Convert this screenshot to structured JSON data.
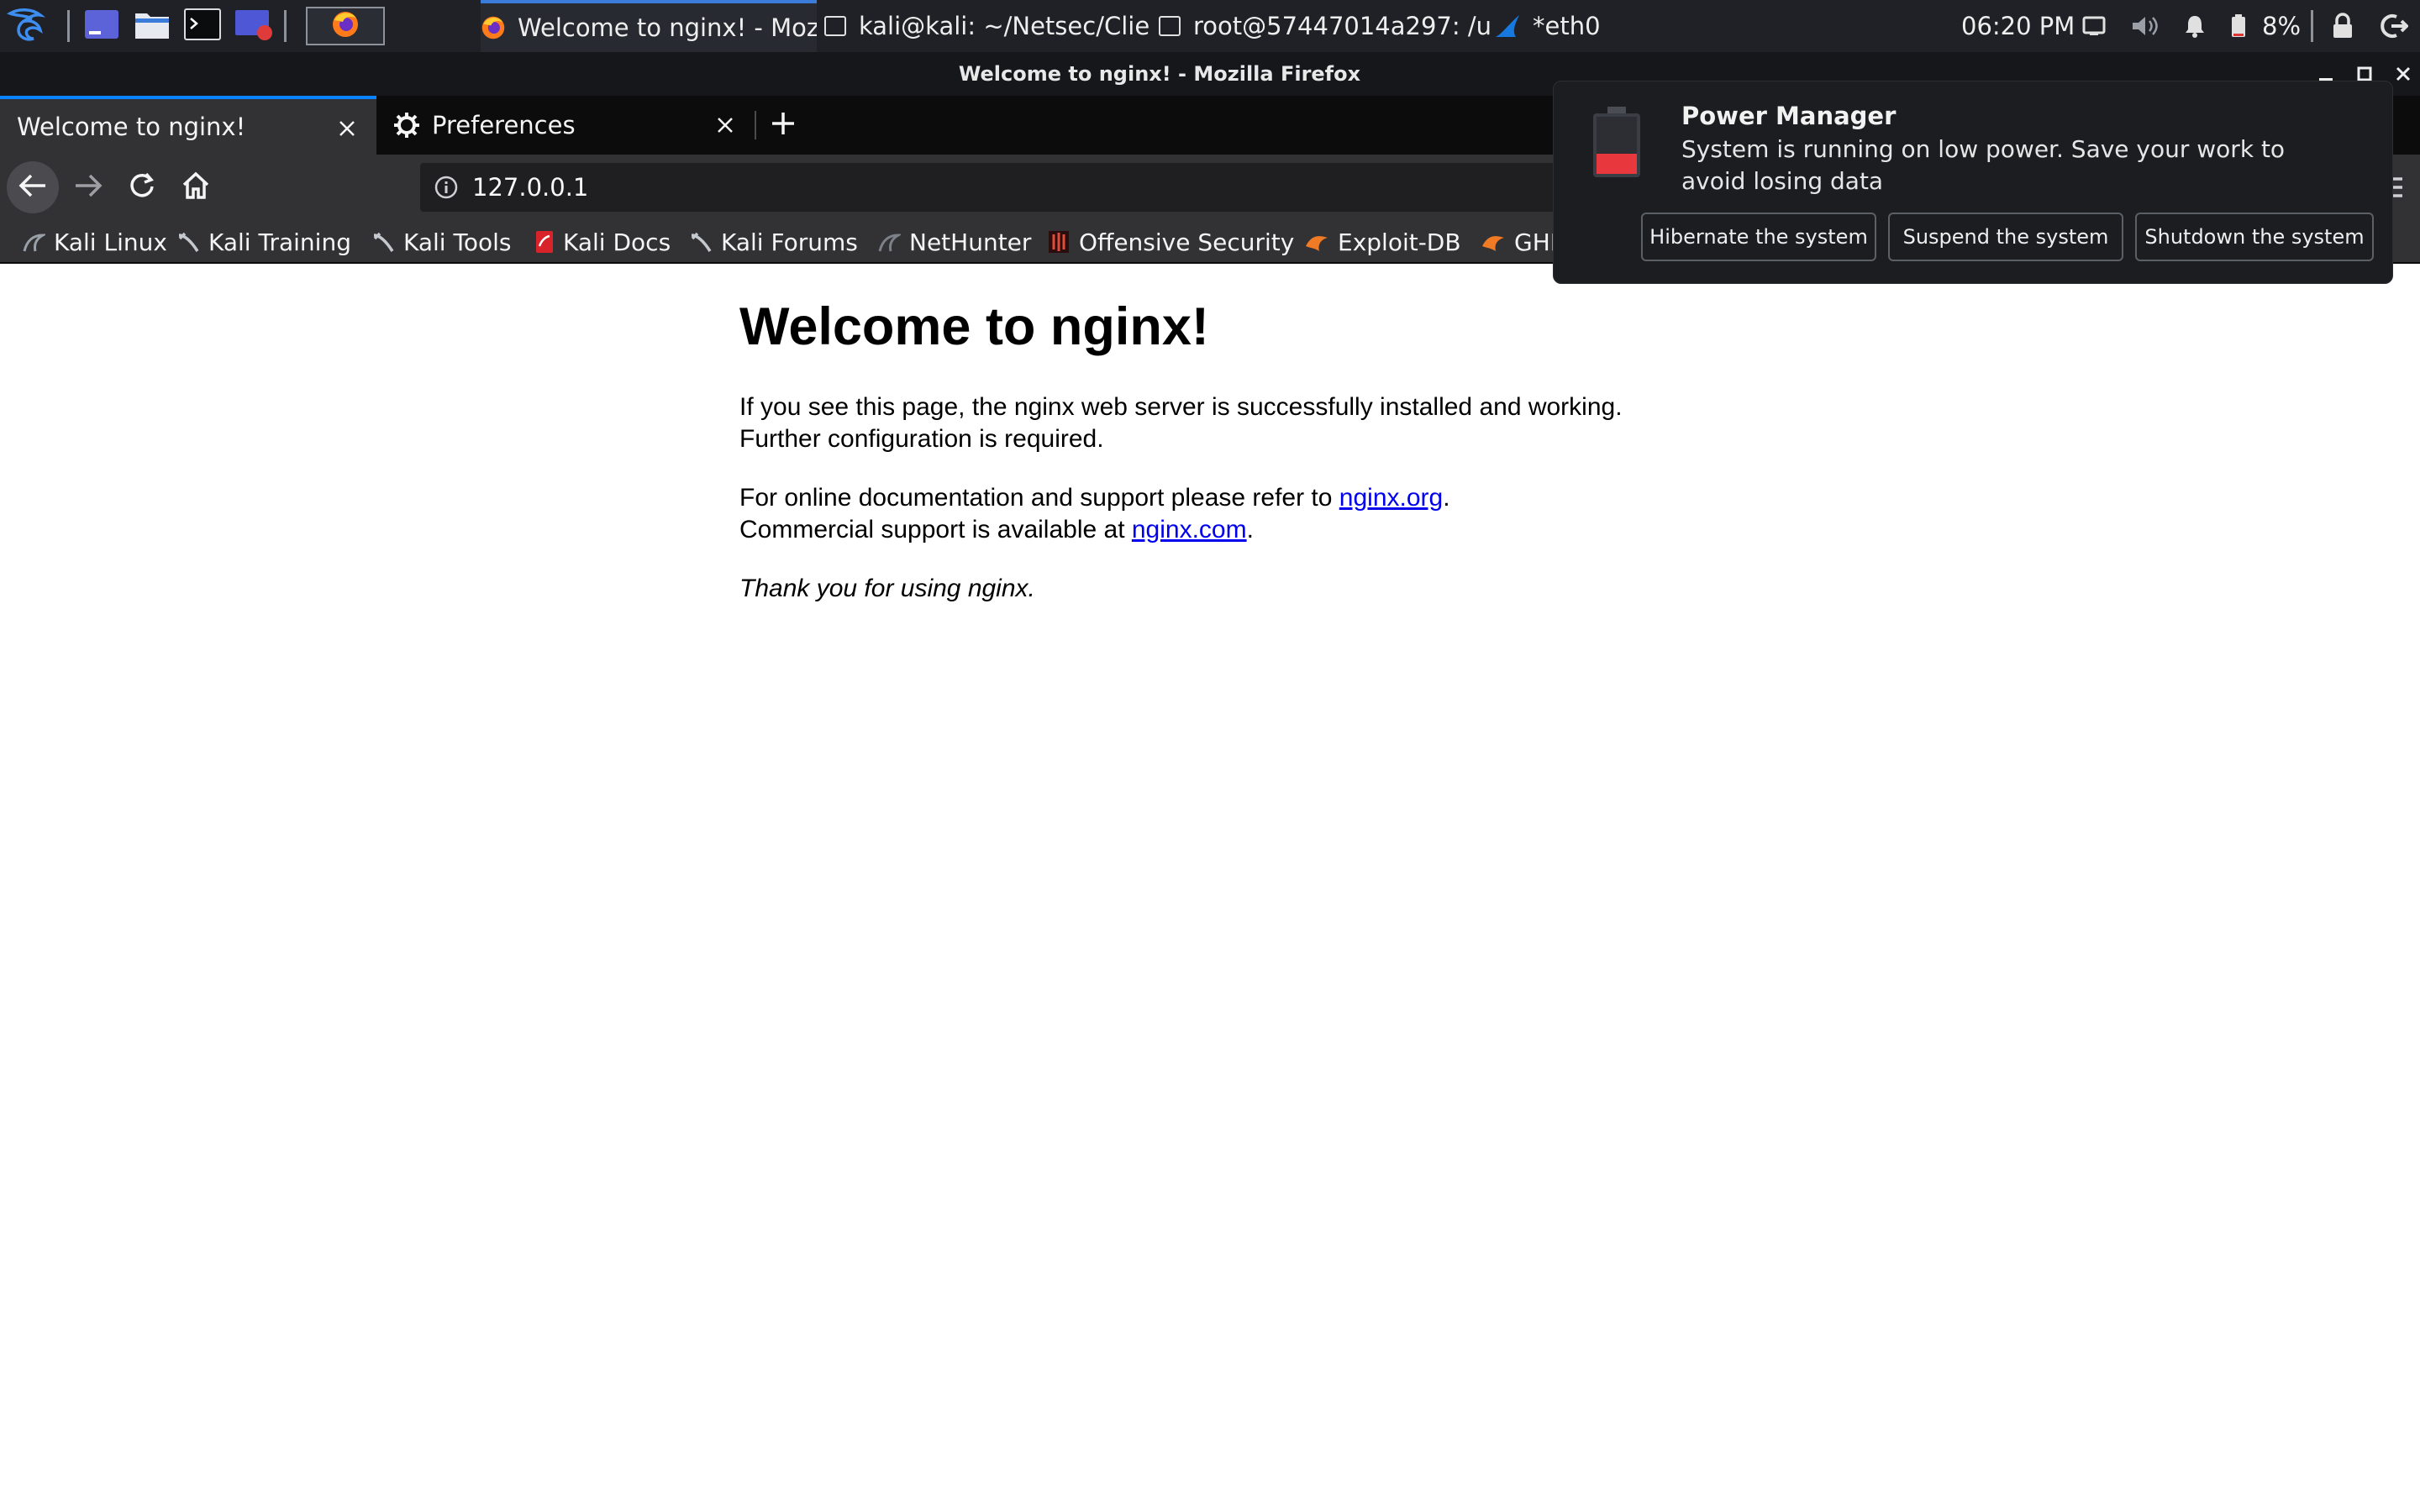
{
  "panel": {
    "launchers": [
      {
        "name": "kali-menu",
        "icon": "kali-dragon-icon"
      },
      {
        "name": "show-desktop",
        "icon": "desktop-icon"
      },
      {
        "name": "file-manager",
        "icon": "folder-icon"
      },
      {
        "name": "terminal",
        "icon": "terminal-icon"
      },
      {
        "name": "screen-recorder",
        "icon": "screen-record-icon"
      },
      {
        "name": "firefox",
        "icon": "firefox-icon"
      }
    ],
    "tasks": [
      {
        "label": "Welcome to nginx! - Moz...",
        "icon": "firefox-icon",
        "active": true
      },
      {
        "label": "kali@kali: ~/Netsec/Clie...",
        "icon": "terminal-window-icon"
      },
      {
        "label": "root@57447014a297: /u...",
        "icon": "terminal-window-icon"
      },
      {
        "label": "*eth0",
        "icon": "wireshark-fin-icon"
      }
    ],
    "clock": "06:20 PM",
    "battery_percent": "8%",
    "battery_level": 0.08
  },
  "window": {
    "title": "Welcome to nginx! - Mozilla Firefox"
  },
  "browser": {
    "tabs": [
      {
        "label": "Welcome to nginx!",
        "active": true
      },
      {
        "label": "Preferences",
        "icon": "gear-icon"
      }
    ],
    "new_tab": "+",
    "url": "127.0.0.1",
    "bookmarks": [
      {
        "label": "Kali Linux",
        "icon": "kali-icon"
      },
      {
        "label": "Kali Training",
        "icon": "kali-icon"
      },
      {
        "label": "Kali Tools",
        "icon": "kali-icon"
      },
      {
        "label": "Kali Docs",
        "icon": "kali-docs-icon"
      },
      {
        "label": "Kali Forums",
        "icon": "kali-icon"
      },
      {
        "label": "NetHunter",
        "icon": "nethunter-icon"
      },
      {
        "label": "Offensive Security",
        "icon": "offsec-icon"
      },
      {
        "label": "Exploit-DB",
        "icon": "exploitdb-icon"
      },
      {
        "label": "GHDB",
        "icon": "exploitdb-icon"
      }
    ]
  },
  "page": {
    "heading": "Welcome to nginx!",
    "para1": "If you see this page, the nginx web server is successfully installed and working. Further configuration is required.",
    "para2_prefix": "For online documentation and support please refer to ",
    "link1": "nginx.org",
    "para2_mid": ".",
    "para2_line2": "Commercial support is available at ",
    "link2": "nginx.com",
    "para2_end": ".",
    "para3": "Thank you for using nginx."
  },
  "notification": {
    "title": "Power Manager",
    "body": "System is running on low power. Save your work to avoid losing data",
    "buttons": [
      "Hibernate the system",
      "Suspend the system",
      "Shutdown the system"
    ]
  }
}
